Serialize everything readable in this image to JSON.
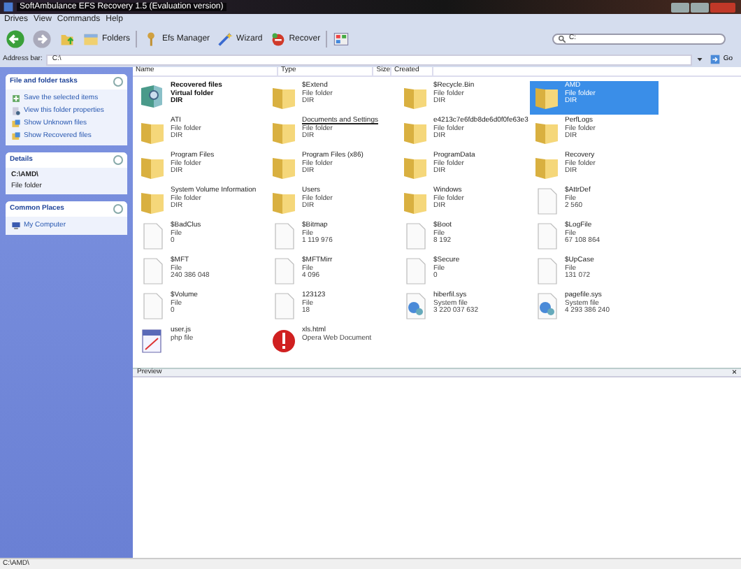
{
  "window": {
    "title": "SoftAmbulance EFS Recovery 1.5 (Evaluation version)"
  },
  "menu": [
    "Drives",
    "View",
    "Commands",
    "Help"
  ],
  "toolbar": [
    {
      "kind": "back"
    },
    {
      "kind": "forward"
    },
    {
      "kind": "up"
    },
    {
      "kind": "folders",
      "label": "Folders"
    },
    {
      "kind": "key",
      "label": "Efs Manager"
    },
    {
      "kind": "wizard",
      "label": "Wizard"
    },
    {
      "kind": "recover",
      "label": "Recover"
    },
    {
      "kind": "views"
    }
  ],
  "search": {
    "value": "C:"
  },
  "address_bar": {
    "label": "Address bar:",
    "value": "C:\\",
    "go": "Go"
  },
  "sidebar": [
    {
      "title": "File and folder tasks",
      "items": [
        {
          "kind": "save",
          "label": "Save the selected items"
        },
        {
          "kind": "props",
          "label": "View this folder properties"
        },
        {
          "kind": "show",
          "label": "Show Unknown files"
        },
        {
          "kind": "show",
          "label": "Show Recovered files"
        }
      ]
    },
    {
      "title": "Details",
      "path": "C:\\AMD\\",
      "description": "File folder"
    },
    {
      "title": "Common Places",
      "items": [
        {
          "kind": "computer",
          "label": "My Computer"
        }
      ]
    }
  ],
  "columns": [
    "Name",
    "Type",
    "Size",
    "Created"
  ],
  "items": [
    {
      "kind": "virtual",
      "name": "Recovered files",
      "type": "Virtual folder",
      "size": "DIR",
      "selected": false
    },
    {
      "kind": "folder",
      "name": "$Extend",
      "type": "File folder",
      "size": "DIR",
      "selected": false
    },
    {
      "kind": "folder",
      "name": "$Recycle.Bin",
      "type": "File folder",
      "size": "DIR",
      "selected": false
    },
    {
      "kind": "folder",
      "name": "AMD",
      "type": "File folder",
      "size": "DIR",
      "selected": true
    },
    {
      "kind": "folder",
      "name": "ATI",
      "type": "File folder",
      "size": "DIR",
      "selected": false
    },
    {
      "kind": "folder",
      "name": "Documents and Settings",
      "type": "File folder",
      "size": "DIR",
      "selected": false,
      "hovered": true
    },
    {
      "kind": "folder",
      "name": "e4213c7e6fdb8de6d0f0fe63e3",
      "type": "File folder",
      "size": "DIR",
      "selected": false
    },
    {
      "kind": "folder",
      "name": "PerfLogs",
      "type": "File folder",
      "size": "DIR",
      "selected": false
    },
    {
      "kind": "folder",
      "name": "Program Files",
      "type": "File folder",
      "size": "DIR",
      "selected": false
    },
    {
      "kind": "folder",
      "name": "Program Files (x86)",
      "type": "File folder",
      "size": "DIR",
      "selected": false
    },
    {
      "kind": "folder",
      "name": "ProgramData",
      "type": "File folder",
      "size": "DIR",
      "selected": false
    },
    {
      "kind": "folder",
      "name": "Recovery",
      "type": "File folder",
      "size": "DIR",
      "selected": false
    },
    {
      "kind": "folder",
      "name": "System Volume Information",
      "type": "File folder",
      "size": "DIR",
      "selected": false
    },
    {
      "kind": "folder",
      "name": "Users",
      "type": "File folder",
      "size": "DIR",
      "selected": false
    },
    {
      "kind": "folder",
      "name": "Windows",
      "type": "File folder",
      "size": "DIR",
      "selected": false
    },
    {
      "kind": "file",
      "name": "$AttrDef",
      "type": "File",
      "size": "2 560",
      "selected": false
    },
    {
      "kind": "file",
      "name": "$BadClus",
      "type": "File",
      "size": "0",
      "selected": false
    },
    {
      "kind": "file",
      "name": "$Bitmap",
      "type": "File",
      "size": "1 119 976",
      "selected": false
    },
    {
      "kind": "file",
      "name": "$Boot",
      "type": "File",
      "size": "8 192",
      "selected": false
    },
    {
      "kind": "file",
      "name": "$LogFile",
      "type": "File",
      "size": "67 108 864",
      "selected": false
    },
    {
      "kind": "file",
      "name": "$MFT",
      "type": "File",
      "size": "240 386 048",
      "selected": false
    },
    {
      "kind": "file",
      "name": "$MFTMirr",
      "type": "File",
      "size": "4 096",
      "selected": false
    },
    {
      "kind": "file",
      "name": "$Secure",
      "type": "File",
      "size": "0",
      "selected": false
    },
    {
      "kind": "file",
      "name": "$UpCase",
      "type": "File",
      "size": "131 072",
      "selected": false
    },
    {
      "kind": "file",
      "name": "$Volume",
      "type": "File",
      "size": "0",
      "selected": false
    },
    {
      "kind": "file",
      "name": "123123",
      "type": "File",
      "size": "18",
      "selected": false
    },
    {
      "kind": "system",
      "name": "hiberfil.sys",
      "type": "System file",
      "size": "3 220 037 632",
      "selected": false
    },
    {
      "kind": "system",
      "name": "pagefile.sys",
      "type": "System file",
      "size": "4 293 386 240",
      "selected": false
    },
    {
      "kind": "script",
      "name": "user.js",
      "type": "php file",
      "selected": false
    },
    {
      "kind": "web",
      "name": "xls.html",
      "type": "Opera Web Document",
      "selected": false
    }
  ],
  "preview": {
    "title": "Preview",
    "close": "×"
  },
  "status_bar": "C:\\AMD\\"
}
